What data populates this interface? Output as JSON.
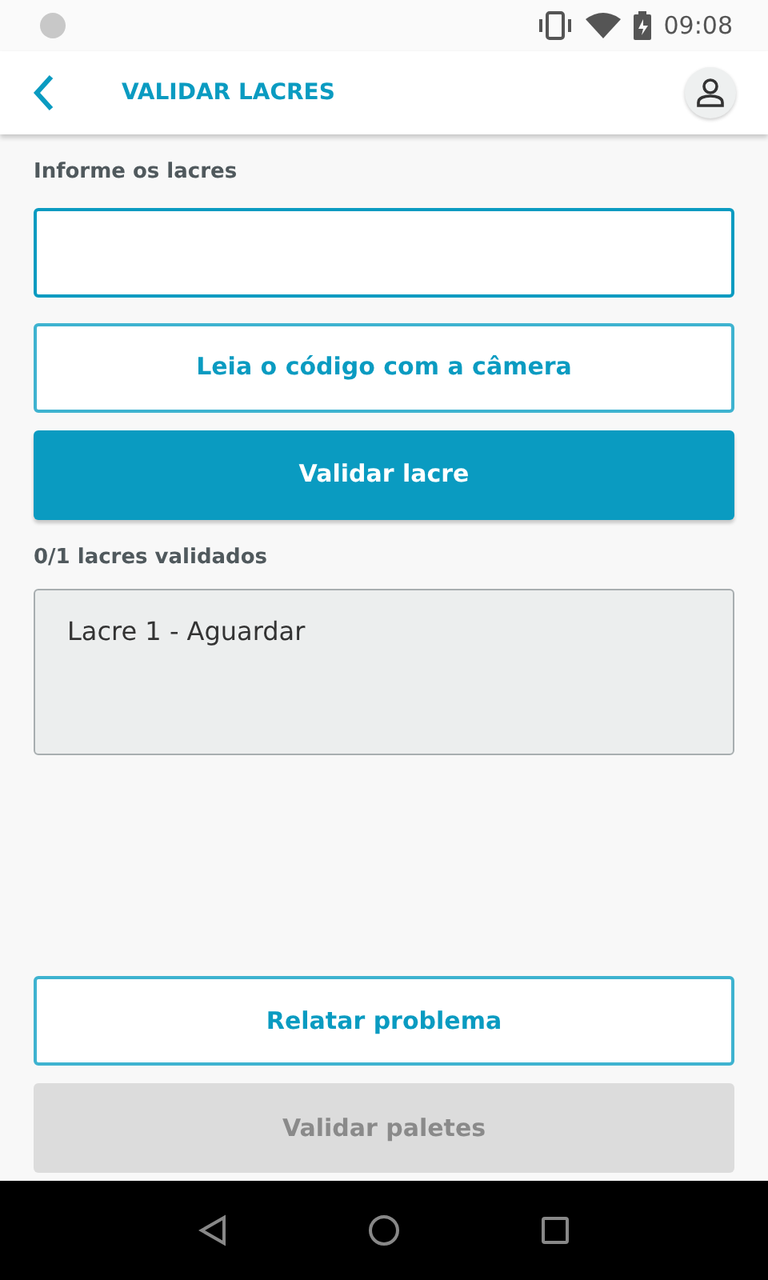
{
  "status_bar": {
    "time": "09:08"
  },
  "header": {
    "title": "VALIDAR LACRES"
  },
  "seal_input": {
    "label": "Informe os lacres"
  },
  "actions": [
    {
      "label": "Leia o código com a câmera",
      "kind": "outline",
      "disabled": false
    },
    {
      "label": "Validar lacre",
      "kind": "primary",
      "disabled": false
    }
  ],
  "progress": "0/1 lacres validados",
  "seals": [
    "Lacre 1 - Aguardar"
  ],
  "footer_buttons": [
    {
      "label": "Relatar problema",
      "kind": "outline",
      "disabled": false
    },
    {
      "label": "Validar paletes",
      "kind": "primary",
      "disabled": true
    }
  ]
}
